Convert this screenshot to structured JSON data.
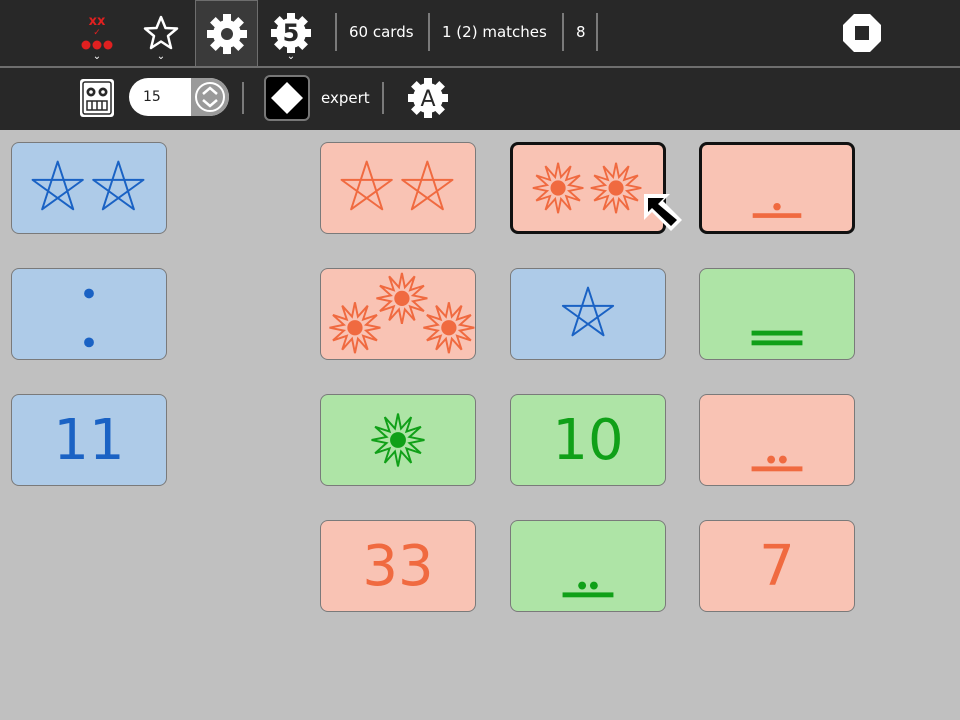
{
  "toolbar": {
    "status_cards": "60 cards",
    "status_matches": "1 (2) matches",
    "status_count": "8",
    "level_label": "expert",
    "time_value": "15"
  },
  "colors": {
    "blue": "#1a62c4",
    "pink": "#f06a40",
    "green": "#10a018"
  },
  "cards": [
    {
      "name": "card-blue-two-stars",
      "kind": "icon",
      "icon": "star",
      "count": 2,
      "color": "blue"
    },
    {
      "name": "card-blue-two-dots",
      "kind": "icon",
      "icon": "dot",
      "count": 2,
      "color": "blue"
    },
    {
      "name": "card-blue-number",
      "kind": "number",
      "text": "11",
      "color": "blue"
    },
    {
      "name": "card-pink-two-stars",
      "kind": "icon",
      "icon": "star",
      "count": 2,
      "color": "pink"
    },
    {
      "name": "card-pink-two-bursts",
      "kind": "icon",
      "icon": "burst",
      "count": 2,
      "color": "pink",
      "selected": true
    },
    {
      "name": "card-pink-mayan-six",
      "kind": "icon",
      "icon": "mayan",
      "count": 6,
      "color": "pink",
      "selected": true
    },
    {
      "name": "card-pink-three-bursts",
      "kind": "icon",
      "icon": "burst",
      "count": 3,
      "color": "pink"
    },
    {
      "name": "card-blue-one-star",
      "kind": "icon",
      "icon": "star",
      "count": 1,
      "color": "blue"
    },
    {
      "name": "card-green-mayan-ten",
      "kind": "icon",
      "icon": "mayan",
      "count": 10,
      "color": "green"
    },
    {
      "name": "card-green-one-burst",
      "kind": "icon",
      "icon": "burst",
      "count": 1,
      "color": "green"
    },
    {
      "name": "card-green-number",
      "kind": "number",
      "text": "10",
      "color": "green"
    },
    {
      "name": "card-pink-mayan-seven",
      "kind": "icon",
      "icon": "mayan",
      "count": 7,
      "color": "pink"
    },
    {
      "name": "card-pink-number-33",
      "kind": "number",
      "text": "33",
      "color": "pink"
    },
    {
      "name": "card-green-mayan-seven",
      "kind": "icon",
      "icon": "mayan",
      "count": 7,
      "color": "green"
    },
    {
      "name": "card-pink-number-7",
      "kind": "number",
      "text": "7",
      "color": "pink"
    }
  ]
}
